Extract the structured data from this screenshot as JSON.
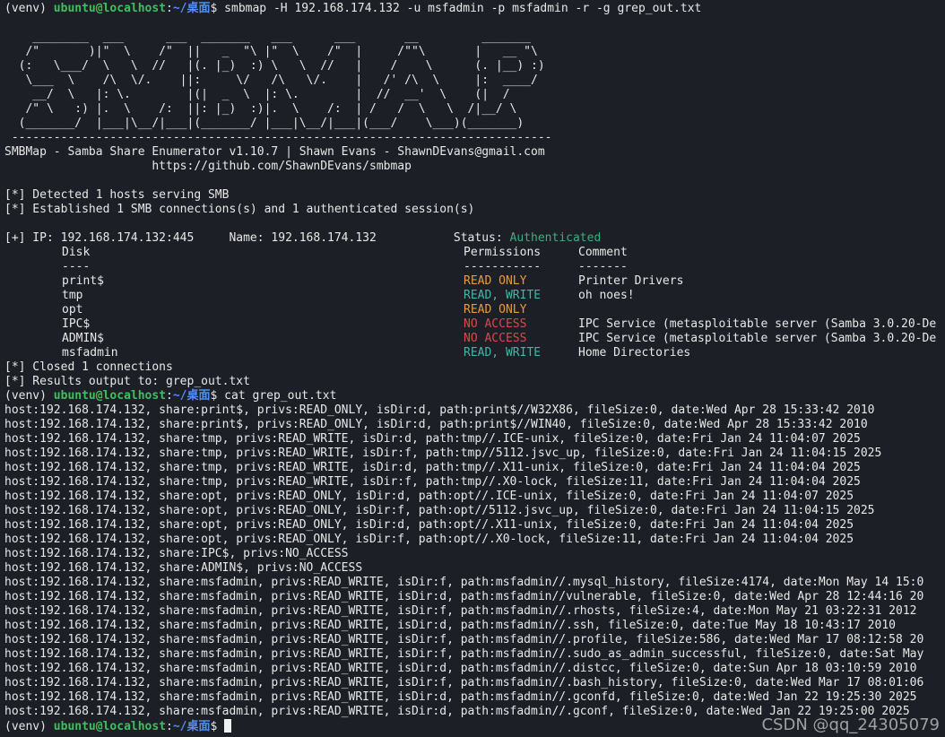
{
  "prompt": {
    "env": "(venv) ",
    "user": "ubuntu@localhost",
    "sep": ":",
    "path": "~/桌面",
    "symbol": "$ "
  },
  "commands": {
    "first": "smbmap -H 192.168.174.132 -u msfadmin -p msfadmin -r -g grep_out.txt",
    "second": "cat grep_out.txt"
  },
  "banner": {
    "art": [
      "",
      "    ________  ___      ___  _______   ___      ___       __         _______",
      "   /\"       )|\"  \\    /\"  ||   _  \"\\ |\"  \\    /\"  |     /\"\"\\       |   __ \"\\",
      "  (:   \\___/  \\   \\  //   |(. |_)  :) \\   \\  //   |    /    \\      (. |__) :)",
      "   \\___  \\    /\\  \\/.    ||:     \\/   /\\   \\/.    |   /' /\\  \\     |:  ____/",
      "    __/  \\   |: \\.        |(|  _  \\  |: \\.        |  //  __'  \\    (|  /",
      "   /\" \\   :) |.  \\    /:  ||: |_)  :)|.  \\    /:  | /   /  \\   \\  /|__/ \\",
      "  (_______/  |___|\\__/|___|(_______/ |___|\\__/|___|(___/    \\___)(_______)",
      " -----------------------------------------------------------------------------"
    ],
    "title": "SMBMap - Samba Share Enumerator v1.10.7 | Shawn Evans - ShawnDEvans@gmail.com",
    "url": "                     https://github.com/ShawnDEvans/smbmap"
  },
  "messages": {
    "detected": "[*] Detected 1 hosts serving SMB",
    "established": "[*] Established 1 SMB connections(s) and 1 authenticated session(s)",
    "closed": "[*] Closed 1 connections",
    "results": "[*] Results output to: grep_out.txt"
  },
  "host_info": {
    "ip_line": "[+] IP: 192.168.174.132:445     Name: 192.168.174.132           ",
    "status_label": "Status: ",
    "status_value": "Authenticated"
  },
  "share_table": {
    "headers": {
      "disk": "Disk",
      "permissions": "Permissions",
      "comment": "Comment"
    },
    "underlines": {
      "disk": "----",
      "permissions": "-----------",
      "comment": "-------"
    },
    "rows": [
      {
        "disk": "print$",
        "perm": "READ ONLY",
        "perm_class": "orange-text",
        "comment": "Printer Drivers"
      },
      {
        "disk": "tmp",
        "perm": "READ, WRITE",
        "perm_class": "teal-text",
        "comment": "oh noes!"
      },
      {
        "disk": "opt",
        "perm": "READ ONLY",
        "perm_class": "orange-text",
        "comment": ""
      },
      {
        "disk": "IPC$",
        "perm": "NO ACCESS",
        "perm_class": "red-text",
        "comment": "IPC Service (metasploitable server (Samba 3.0.20-De"
      },
      {
        "disk": "ADMIN$",
        "perm": "NO ACCESS",
        "perm_class": "red-text",
        "comment": "IPC Service (metasploitable server (Samba 3.0.20-De"
      },
      {
        "disk": "msfadmin",
        "perm": "READ, WRITE",
        "perm_class": "teal-text",
        "comment": "Home Directories"
      }
    ]
  },
  "grep_output": [
    "host:192.168.174.132, share:print$, privs:READ_ONLY, isDir:d, path:print$//W32X86, fileSize:0, date:Wed Apr 28 15:33:42 2010",
    "host:192.168.174.132, share:print$, privs:READ_ONLY, isDir:d, path:print$//WIN40, fileSize:0, date:Wed Apr 28 15:33:42 2010",
    "host:192.168.174.132, share:tmp, privs:READ_WRITE, isDir:d, path:tmp//.ICE-unix, fileSize:0, date:Fri Jan 24 11:04:07 2025",
    "host:192.168.174.132, share:tmp, privs:READ_WRITE, isDir:f, path:tmp//5112.jsvc_up, fileSize:0, date:Fri Jan 24 11:04:15 2025",
    "host:192.168.174.132, share:tmp, privs:READ_WRITE, isDir:d, path:tmp//.X11-unix, fileSize:0, date:Fri Jan 24 11:04:04 2025",
    "host:192.168.174.132, share:tmp, privs:READ_WRITE, isDir:f, path:tmp//.X0-lock, fileSize:11, date:Fri Jan 24 11:04:04 2025",
    "host:192.168.174.132, share:opt, privs:READ_ONLY, isDir:d, path:opt//.ICE-unix, fileSize:0, date:Fri Jan 24 11:04:07 2025",
    "host:192.168.174.132, share:opt, privs:READ_ONLY, isDir:f, path:opt//5112.jsvc_up, fileSize:0, date:Fri Jan 24 11:04:15 2025",
    "host:192.168.174.132, share:opt, privs:READ_ONLY, isDir:d, path:opt//.X11-unix, fileSize:0, date:Fri Jan 24 11:04:04 2025",
    "host:192.168.174.132, share:opt, privs:READ_ONLY, isDir:f, path:opt//.X0-lock, fileSize:11, date:Fri Jan 24 11:04:04 2025",
    "host:192.168.174.132, share:IPC$, privs:NO_ACCESS",
    "host:192.168.174.132, share:ADMIN$, privs:NO_ACCESS",
    "host:192.168.174.132, share:msfadmin, privs:READ_WRITE, isDir:f, path:msfadmin//.mysql_history, fileSize:4174, date:Mon May 14 15:0",
    "host:192.168.174.132, share:msfadmin, privs:READ_WRITE, isDir:d, path:msfadmin//vulnerable, fileSize:0, date:Wed Apr 28 12:44:16 20",
    "host:192.168.174.132, share:msfadmin, privs:READ_WRITE, isDir:f, path:msfadmin//.rhosts, fileSize:4, date:Mon May 21 03:22:31 2012",
    "host:192.168.174.132, share:msfadmin, privs:READ_WRITE, isDir:d, path:msfadmin//.ssh, fileSize:0, date:Tue May 18 10:43:17 2010",
    "host:192.168.174.132, share:msfadmin, privs:READ_WRITE, isDir:f, path:msfadmin//.profile, fileSize:586, date:Wed Mar 17 08:12:58 20",
    "host:192.168.174.132, share:msfadmin, privs:READ_WRITE, isDir:f, path:msfadmin//.sudo_as_admin_successful, fileSize:0, date:Sat May",
    "host:192.168.174.132, share:msfadmin, privs:READ_WRITE, isDir:d, path:msfadmin//.distcc, fileSize:0, date:Sun Apr 18 03:10:59 2010",
    "host:192.168.174.132, share:msfadmin, privs:READ_WRITE, isDir:f, path:msfadmin//.bash_history, fileSize:0, date:Wed Mar 17 08:01:06",
    "host:192.168.174.132, share:msfadmin, privs:READ_WRITE, isDir:d, path:msfadmin//.gconfd, fileSize:0, date:Wed Jan 22 19:25:30 2025",
    "host:192.168.174.132, share:msfadmin, privs:READ_WRITE, isDir:d, path:msfadmin//.gconf, fileSize:0, date:Wed Jan 22 19:25:00 2025"
  ],
  "watermark": "CSDN @qq_24305079"
}
